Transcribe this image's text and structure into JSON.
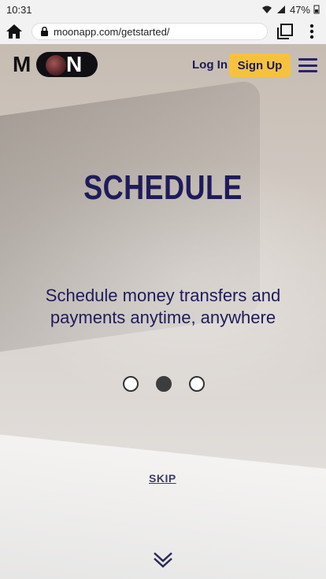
{
  "status_bar": {
    "time": "10:31",
    "battery": "47%"
  },
  "browser": {
    "url": "moonapp.com/getstarted/"
  },
  "nav": {
    "logo_text_m": "M",
    "logo_text_n": "N",
    "login_label": "Log In",
    "signup_label": "Sign Up"
  },
  "hero": {
    "title": "SCHEDULE",
    "subtitle": "Schedule money transfers and payments anytime, anywhere",
    "skip_label": "SKIP",
    "carousel": {
      "total": 3,
      "active_index": 1
    }
  },
  "colors": {
    "accent_yellow": "#f6c23e",
    "brand_navy": "#1f1b5a"
  },
  "icons": [
    "home-icon",
    "lock-icon",
    "tabs-icon",
    "more-vert-icon",
    "wifi-icon",
    "signal-icon",
    "battery-icon",
    "hamburger-icon",
    "chevron-down-icon"
  ]
}
